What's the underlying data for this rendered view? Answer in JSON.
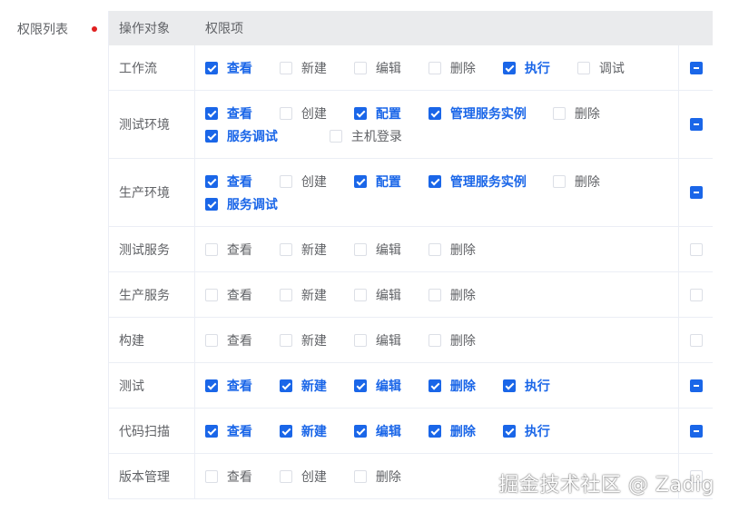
{
  "form": {
    "field_label": "权限列表"
  },
  "table": {
    "headers": {
      "object": "操作对象",
      "permissions": "权限项"
    },
    "rows": [
      {
        "name": "工作流",
        "perms": [
          {
            "label": "查看",
            "checked": true
          },
          {
            "label": "新建",
            "checked": false
          },
          {
            "label": "编辑",
            "checked": false
          },
          {
            "label": "删除",
            "checked": false
          },
          {
            "label": "执行",
            "checked": true
          },
          {
            "label": "调试",
            "checked": false
          }
        ],
        "all_state": "indeterminate"
      },
      {
        "name": "测试环境",
        "perms": [
          {
            "label": "查看",
            "checked": true
          },
          {
            "label": "创建",
            "checked": false
          },
          {
            "label": "配置",
            "checked": true
          },
          {
            "label": "管理服务实例",
            "checked": true,
            "wide": true
          },
          {
            "label": "删除",
            "checked": false
          },
          {
            "label": "服务调试",
            "checked": true,
            "wide": true
          },
          {
            "label": "主机登录",
            "checked": false
          }
        ],
        "all_state": "indeterminate"
      },
      {
        "name": "生产环境",
        "perms": [
          {
            "label": "查看",
            "checked": true
          },
          {
            "label": "创建",
            "checked": false
          },
          {
            "label": "配置",
            "checked": true
          },
          {
            "label": "管理服务实例",
            "checked": true,
            "wide": true
          },
          {
            "label": "删除",
            "checked": false
          },
          {
            "label": "服务调试",
            "checked": true,
            "wide": true
          }
        ],
        "all_state": "indeterminate"
      },
      {
        "name": "测试服务",
        "perms": [
          {
            "label": "查看",
            "checked": false
          },
          {
            "label": "新建",
            "checked": false
          },
          {
            "label": "编辑",
            "checked": false
          },
          {
            "label": "删除",
            "checked": false
          }
        ],
        "all_state": "unchecked"
      },
      {
        "name": "生产服务",
        "perms": [
          {
            "label": "查看",
            "checked": false
          },
          {
            "label": "新建",
            "checked": false
          },
          {
            "label": "编辑",
            "checked": false
          },
          {
            "label": "删除",
            "checked": false
          }
        ],
        "all_state": "unchecked"
      },
      {
        "name": "构建",
        "perms": [
          {
            "label": "查看",
            "checked": false
          },
          {
            "label": "新建",
            "checked": false
          },
          {
            "label": "编辑",
            "checked": false
          },
          {
            "label": "删除",
            "checked": false
          }
        ],
        "all_state": "unchecked"
      },
      {
        "name": "测试",
        "perms": [
          {
            "label": "查看",
            "checked": true
          },
          {
            "label": "新建",
            "checked": true
          },
          {
            "label": "编辑",
            "checked": true
          },
          {
            "label": "删除",
            "checked": true
          },
          {
            "label": "执行",
            "checked": true
          }
        ],
        "all_state": "indeterminate"
      },
      {
        "name": "代码扫描",
        "perms": [
          {
            "label": "查看",
            "checked": true
          },
          {
            "label": "新建",
            "checked": true
          },
          {
            "label": "编辑",
            "checked": true
          },
          {
            "label": "删除",
            "checked": true
          },
          {
            "label": "执行",
            "checked": true
          }
        ],
        "all_state": "indeterminate"
      },
      {
        "name": "版本管理",
        "perms": [
          {
            "label": "查看",
            "checked": false
          },
          {
            "label": "创建",
            "checked": false
          },
          {
            "label": "删除",
            "checked": false
          }
        ],
        "all_state": "unchecked"
      }
    ]
  },
  "watermark": "掘金技术社区 @ Zadig",
  "colors": {
    "accent": "#1a66e8",
    "required": "#e02020",
    "header_bg": "#eaebed",
    "border": "#ebeef5"
  }
}
